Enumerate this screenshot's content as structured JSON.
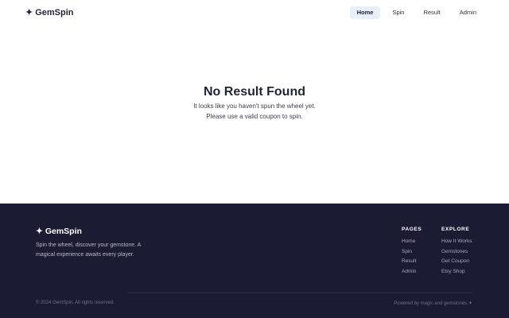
{
  "header": {
    "logo_symbol": "✦",
    "logo_text": "GemSpin",
    "nav": [
      {
        "label": "Home",
        "active": true
      },
      {
        "label": "Spin",
        "active": false
      },
      {
        "label": "Result",
        "active": false
      },
      {
        "label": "Admin",
        "active": false
      }
    ]
  },
  "main": {
    "title": "No Result Found",
    "line1": "It looks like you haven't spun the wheel yet.",
    "line2": "Please use a valid coupon to spin."
  },
  "footer": {
    "logo_symbol": "✦",
    "logo_text": "GemSpin",
    "description": "Spin the wheel, discover your gemstone. A magical experience awaits every player.",
    "pages": {
      "title": "PAGES",
      "links": [
        "Home",
        "Spin",
        "Result",
        "Admin"
      ]
    },
    "explore": {
      "title": "EXPLORE",
      "links": [
        "How It Works",
        "Gemstones",
        "Get Coupon",
        "Etsy Shop"
      ]
    },
    "copyright": "© 2024 GemSpin. All rights reserved.",
    "powered": "Powered by magic and gemstones ✦"
  },
  "colors": {
    "footer_bg": "#1c1b34",
    "nav_active_bg": "#eaf0fb",
    "text_dark": "#1f2433"
  }
}
